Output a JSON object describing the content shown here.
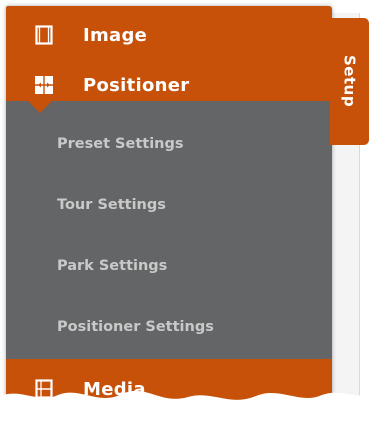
{
  "menu": {
    "items": [
      {
        "label": "Image",
        "icon": "film-frame-icon"
      },
      {
        "label": "Positioner",
        "icon": "positioner-icon"
      },
      {
        "label": "Media",
        "icon": "media-icon"
      }
    ],
    "submenu": [
      {
        "label": "Preset Settings"
      },
      {
        "label": "Tour Settings"
      },
      {
        "label": "Park Settings"
      },
      {
        "label": "Positioner Settings"
      }
    ]
  },
  "tab": {
    "label": "Setup"
  },
  "colors": {
    "accent": "#c75109",
    "submenu_bg": "#636566",
    "submenu_text": "#c9c9c9",
    "label_text": "#ffffff"
  }
}
